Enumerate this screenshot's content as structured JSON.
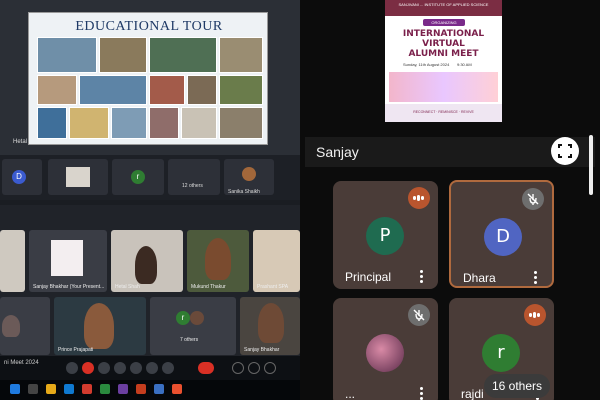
{
  "left": {
    "slide_title": "EDUCATIONAL TOUR",
    "presenter_label": "Hetal",
    "top_strip": {
      "avatar_d": "D",
      "avatar_r": "r",
      "others_label": "12 others",
      "tile_label": "Sanika Shaikh"
    },
    "grid": {
      "tile_sanjay": "Sanjay Bhakhar (Your Present...",
      "tile_hetal": "Hetal Shah",
      "tile_mukund": "Mukund Thakur",
      "tile_prashant": "Prashant SPA",
      "tile_prince": "Prince Prajapati",
      "tile_others": "7 others",
      "tile_sanjay2": "Sanjay Bhakhar",
      "avatar_r": "r"
    },
    "meet_name": "ni Meet 2024"
  },
  "poster": {
    "org": "SANJIVANI ... INSTITUTE OF APPLIED SCIENCE",
    "badge": "ORGANIZING",
    "title_line1": "INTERNATIONAL",
    "title_line2": "VIRTUAL",
    "title_line3": "ALUMNI MEET",
    "date": "Sunday, 11th August 2024",
    "time": "9:30 AM",
    "tags": "RECONNECT · REMINISCE · REVIVE"
  },
  "call": {
    "title": "Sanjay",
    "participants": [
      {
        "name": "Principal",
        "initial": "P",
        "color": "#1f6b50",
        "status": "speaking"
      },
      {
        "name": "Dhara",
        "initial": "D",
        "color": "#5065c2",
        "status": "muted"
      },
      {
        "name": "...",
        "initial": "",
        "color": "#7a3f6b",
        "status": "muted"
      },
      {
        "name": "rajdi",
        "initial": "r",
        "color": "#2f7d32",
        "status": "speaking"
      }
    ],
    "others_label": "16 others"
  },
  "colors": {
    "tile_bg": "#4a3c38",
    "speaking_badge": "#b9552e",
    "muted_badge": "#6e6e6e",
    "active_border": "#b06a3e",
    "end_call": "#d93025"
  }
}
